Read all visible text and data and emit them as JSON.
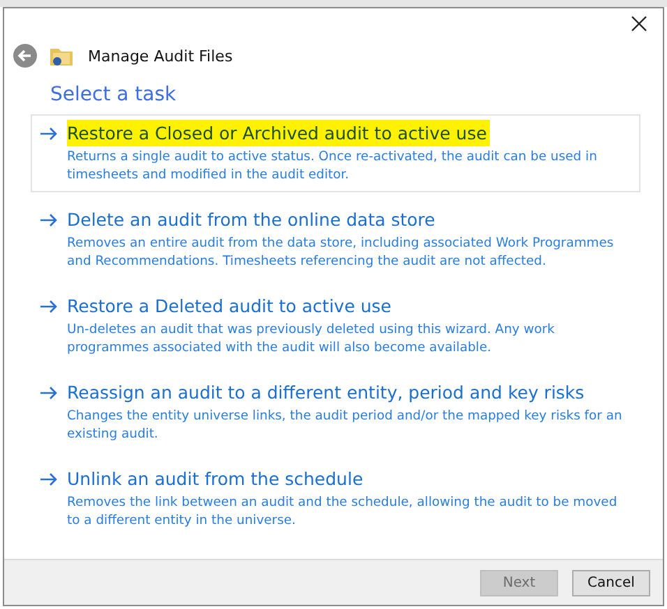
{
  "window": {
    "title": "Manage Audit Files"
  },
  "heading": "Select a task",
  "tasks": [
    {
      "title": "Restore a Closed or Archived audit to active use",
      "description": "Returns a single audit to active status. Once re-activated, the audit can be used in timesheets and modified in the audit editor.",
      "selected": true,
      "highlighted": true
    },
    {
      "title": "Delete an audit from the online data store",
      "description": "Removes an entire audit from the data store, including associated Work Programmes and Recommendations. Timesheets referencing the audit are not affected.",
      "selected": false,
      "highlighted": false
    },
    {
      "title": "Restore a Deleted audit to active use",
      "description": "Un-deletes an audit that was previously deleted using this wizard. Any work programmes associated with the audit will also become available.",
      "selected": false,
      "highlighted": false
    },
    {
      "title": "Reassign an audit to a different entity, period and key risks",
      "description": "Changes the entity universe links, the audit period and/or the mapped key risks for an existing audit.",
      "selected": false,
      "highlighted": false
    },
    {
      "title": "Unlink an audit from the schedule",
      "description": "Removes the link between an audit and the schedule, allowing the audit to be moved to a different entity in the universe.",
      "selected": false,
      "highlighted": false
    }
  ],
  "buttons": [
    {
      "label": "Next",
      "disabled": true
    },
    {
      "label": "Cancel",
      "disabled": false
    }
  ]
}
